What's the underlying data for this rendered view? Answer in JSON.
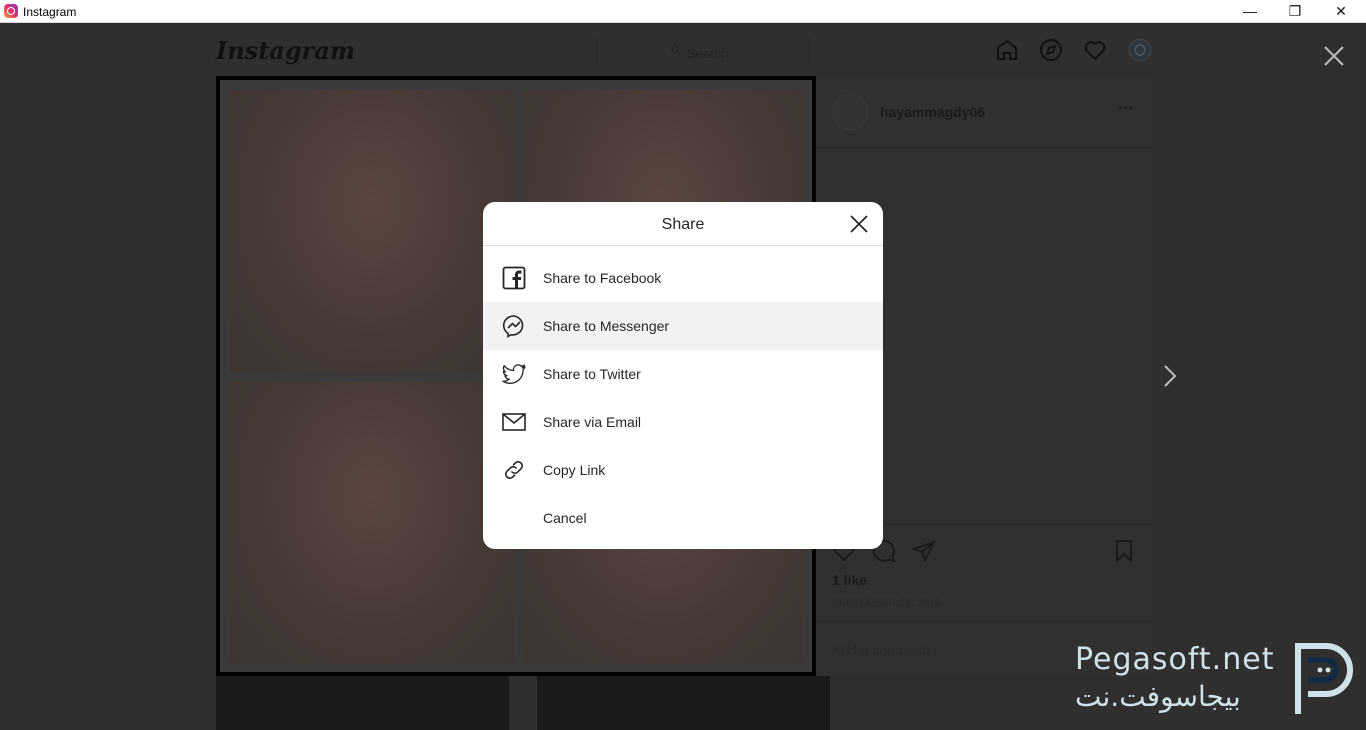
{
  "window": {
    "title": "Instagram",
    "controls": [
      "—",
      "❐",
      "✕"
    ]
  },
  "header": {
    "logo": "Instagram",
    "search_placeholder": "Search",
    "icons": [
      "home-icon",
      "explore-icon",
      "activity-heart-icon",
      "profile-avatar"
    ]
  },
  "post": {
    "username": "hayammagdy06",
    "more": "···",
    "likes": "1 like",
    "date": "SEPTEMBER 27, 2019",
    "comment_placeholder": "Add a comment..."
  },
  "share_dialog": {
    "title": "Share",
    "options": [
      {
        "label": "Share to Facebook",
        "icon": "facebook-icon"
      },
      {
        "label": "Share to Messenger",
        "icon": "messenger-icon",
        "highlighted": true
      },
      {
        "label": "Share to Twitter",
        "icon": "twitter-icon"
      },
      {
        "label": "Share via Email",
        "icon": "email-icon"
      },
      {
        "label": "Copy Link",
        "icon": "link-icon"
      },
      {
        "label": "Cancel",
        "icon": ""
      }
    ]
  },
  "watermark": {
    "latin": "Pegasoft.net",
    "arabic": "بيجاسوفت.نت"
  }
}
